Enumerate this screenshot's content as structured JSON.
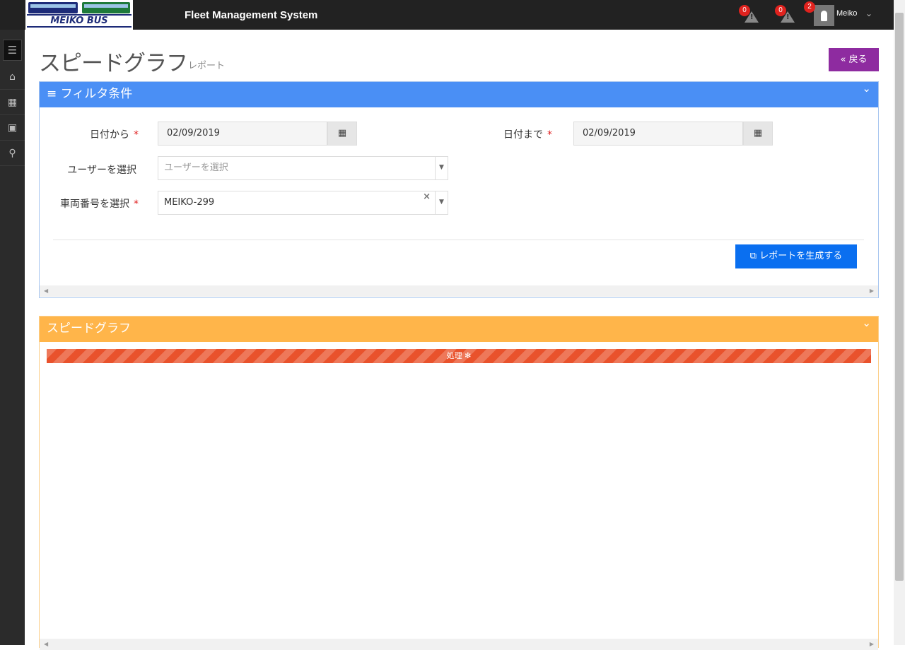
{
  "header": {
    "logo_text": "MEIKO BUS",
    "app_title": "Fleet Management System",
    "alerts": [
      {
        "count": "0"
      },
      {
        "count": "0"
      }
    ],
    "user": {
      "badge": "2",
      "name": "Meiko"
    }
  },
  "page": {
    "title": "スピードグラフ",
    "subtitle": "レポート",
    "back_label": "« 戻る"
  },
  "filter_panel": {
    "title": "≡ フィルタ条件",
    "date_from": {
      "label": "日付から",
      "value": "02/09/2019"
    },
    "date_to": {
      "label": "日付まで",
      "value": "02/09/2019"
    },
    "user_select": {
      "label": "ユーザーを選択",
      "placeholder": "ユーザーを選択"
    },
    "vehicle_select": {
      "label": "車両番号を選択",
      "value": "MEIKO-299"
    },
    "generate_label": "レポートを生成する",
    "required_mark": "*"
  },
  "graph_panel": {
    "title": "スピードグラフ",
    "progress_text": "処理 ✻"
  },
  "icons": [
    "menu-icon",
    "home-icon",
    "table-icon",
    "bus-icon",
    "map-marker-icon",
    "calendar-icon",
    "external-link-icon",
    "chevron-down-icon",
    "warning-icon"
  ],
  "colors": {
    "filter_header": "#4a8ff5",
    "graph_header": "#ffb54a",
    "back_button": "#8e2ba0",
    "generate_button": "#0a6ff0",
    "progress": "#e9522c"
  }
}
